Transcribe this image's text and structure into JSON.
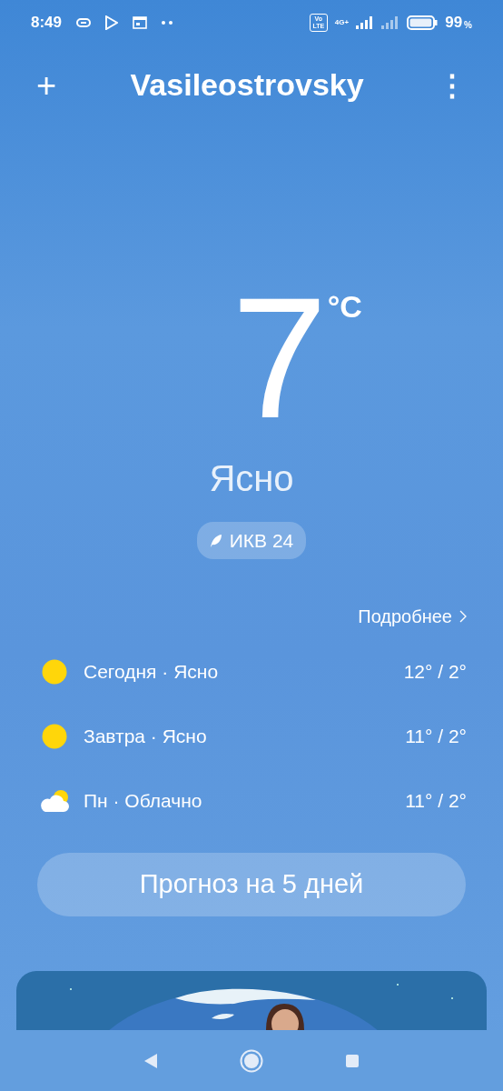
{
  "status_bar": {
    "time": "8:49",
    "volte": "Vo LTE",
    "network": "4G+",
    "battery_percent": "99",
    "percent_sign": "%",
    "level": 0.99
  },
  "header": {
    "add": "+",
    "city": "Vasileostrovsky",
    "menu": "⋮"
  },
  "current": {
    "temperature": "7",
    "unit": "°C",
    "condition": "Ясно",
    "aqi": "ИКВ 24"
  },
  "details_link": "Подробнее",
  "forecast": [
    {
      "kind": "sun",
      "label": "Сегодня · Ясно",
      "temps": "12° / 2°"
    },
    {
      "kind": "sun",
      "label": "Завтра · Ясно",
      "temps": "11° / 2°"
    },
    {
      "kind": "partly_cloudy",
      "label": "Пн · Облачно",
      "temps": "11° / 2°"
    }
  ],
  "forecast_button": "Прогноз на 5 дней"
}
